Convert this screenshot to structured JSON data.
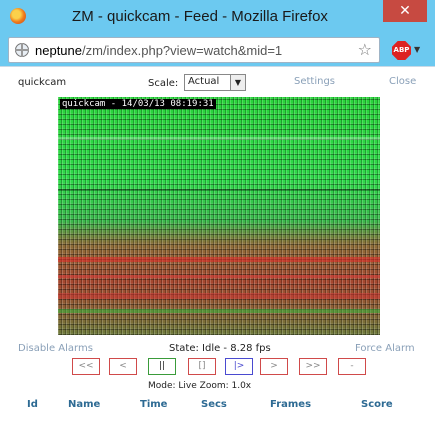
{
  "window": {
    "title": "ZM - quickcam - Feed - Mozilla Firefox",
    "close_glyph": "✕"
  },
  "address_bar": {
    "host": "neptune",
    "path": "/zm/index.php?view=watch&mid=1",
    "star_glyph": "☆",
    "abp_label": "ABP"
  },
  "header": {
    "monitor_name": "quickcam",
    "scale_label": "Scale:",
    "scale_value": "Actual",
    "settings_label": "Settings",
    "close_label": "Close"
  },
  "feed": {
    "timestamp": "quickcam - 14/03/13 08:19:31"
  },
  "status": {
    "disable_alarms_label": "Disable Alarms",
    "state_text": "State: Idle - 8.28 fps",
    "force_alarm_label": "Force Alarm"
  },
  "controls": [
    {
      "name": "fast-rewind-button",
      "label": "<<",
      "style": "red"
    },
    {
      "name": "slow-rewind-button",
      "label": "<",
      "style": "red"
    },
    {
      "name": "pause-button",
      "label": "||",
      "style": "green"
    },
    {
      "name": "stop-button",
      "label": "[]",
      "style": "red"
    },
    {
      "name": "play-button",
      "label": "|>",
      "style": "blue"
    },
    {
      "name": "slow-forward-button",
      "label": ">",
      "style": "red"
    },
    {
      "name": "fast-forward-button",
      "label": ">>",
      "style": "red"
    },
    {
      "name": "zoom-out-button",
      "label": "-",
      "style": "red"
    }
  ],
  "mode_text": "Mode: Live   Zoom: 1.0x",
  "events_table": {
    "columns": [
      "Id",
      "Name",
      "Time",
      "Secs",
      "Frames",
      "Score"
    ]
  },
  "colors": {
    "titlebar": "#6cc9f0",
    "link": "#8aa0b8",
    "table_header": "#2d6a93",
    "button_border_red": "#d04a4a"
  }
}
